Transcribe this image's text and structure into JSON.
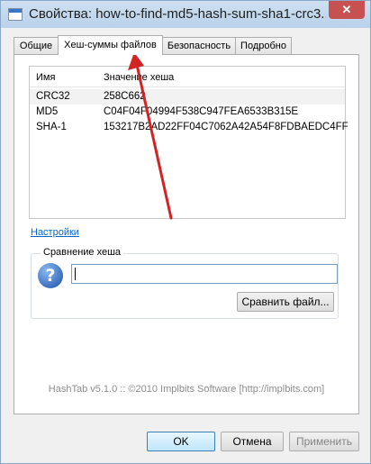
{
  "window": {
    "title": "Свойства: how-to-find-md5-hash-sum-sha1-crc3...",
    "close_label": "✕"
  },
  "tabs": [
    {
      "label": "Общие"
    },
    {
      "label": "Хеш-суммы файлов"
    },
    {
      "label": "Безопасность"
    },
    {
      "label": "Подробно"
    }
  ],
  "hash_table": {
    "columns": [
      "Имя",
      "Значение хеша"
    ],
    "rows": [
      {
        "name": "CRC32",
        "value": "258C662"
      },
      {
        "name": "MD5",
        "value": "C04F04F04994F538C947FEA6533B315E"
      },
      {
        "name": "SHA-1",
        "value": "153217B2AD22FF04C7062A42A54F8FDBAEDC4FF"
      }
    ]
  },
  "settings_link": "Настройки",
  "hash_compare": {
    "label": "Сравнение хеша",
    "input_value": "",
    "compare_button": "Сравнить файл..."
  },
  "footer": "HashTab v5.1.0 :: ©2010 Implbits Software [http://implbits.com]",
  "buttons": {
    "ok": "OK",
    "cancel": "Отмена",
    "apply": "Применить"
  },
  "colors": {
    "annotation_arrow": "#d32424",
    "link": "#0066cc"
  }
}
